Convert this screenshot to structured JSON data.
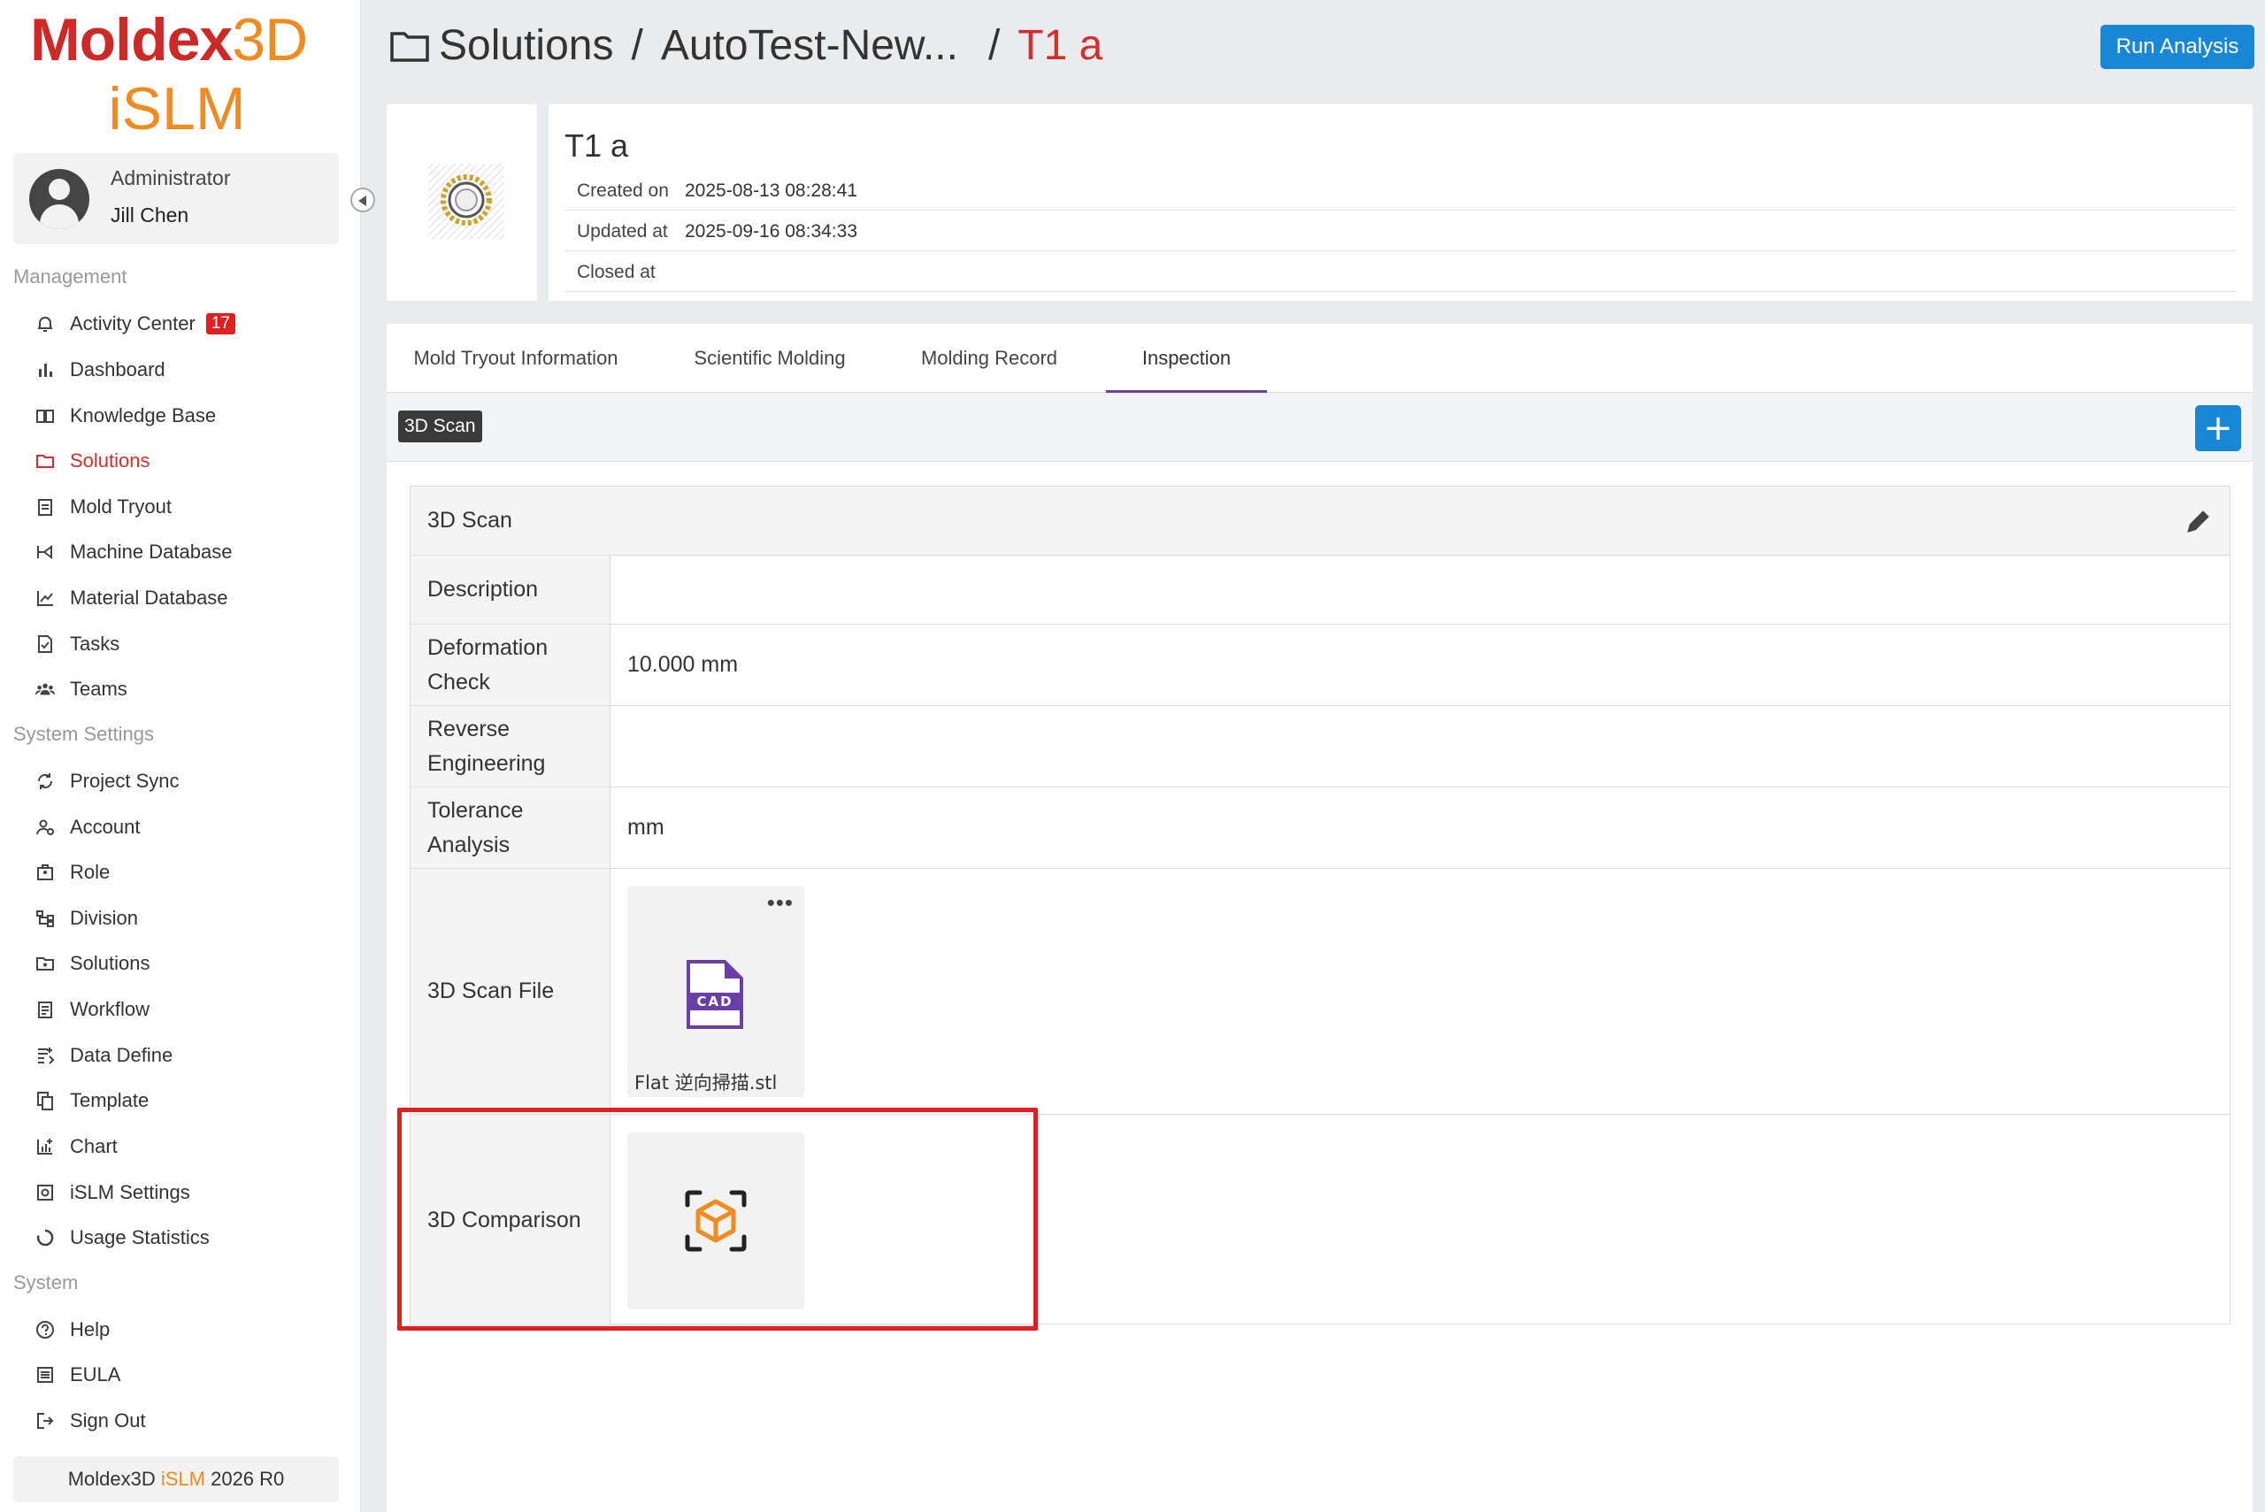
{
  "brand": {
    "line1a": "Moldex",
    "line1b": "3D",
    "line2": "iSLM"
  },
  "user": {
    "role": "Administrator",
    "name": "Jill Chen"
  },
  "sidebar": {
    "management_label": "Management",
    "management": [
      {
        "label": "Activity Center",
        "icon": "bell-icon",
        "badge": "17"
      },
      {
        "label": "Dashboard",
        "icon": "bar-chart-icon"
      },
      {
        "label": "Knowledge Base",
        "icon": "book-icon"
      },
      {
        "label": "Solutions",
        "icon": "folder-icon",
        "active": true
      },
      {
        "label": "Mold Tryout",
        "icon": "clipboard-icon"
      },
      {
        "label": "Machine Database",
        "icon": "machine-icon"
      },
      {
        "label": "Material Database",
        "icon": "material-chart-icon"
      },
      {
        "label": "Tasks",
        "icon": "task-icon"
      },
      {
        "label": "Teams",
        "icon": "team-icon"
      }
    ],
    "system_settings_label": "System Settings",
    "system_settings": [
      {
        "label": "Project Sync",
        "icon": "sync-icon"
      },
      {
        "label": "Account",
        "icon": "account-icon"
      },
      {
        "label": "Role",
        "icon": "role-icon"
      },
      {
        "label": "Division",
        "icon": "division-icon"
      },
      {
        "label": "Solutions",
        "icon": "solutions-settings-icon"
      },
      {
        "label": "Workflow",
        "icon": "workflow-icon"
      },
      {
        "label": "Data Define",
        "icon": "data-define-icon"
      },
      {
        "label": "Template",
        "icon": "template-icon"
      },
      {
        "label": "Chart",
        "icon": "chart-icon"
      },
      {
        "label": "iSLM Settings",
        "icon": "settings-icon"
      },
      {
        "label": "Usage Statistics",
        "icon": "usage-icon"
      }
    ],
    "system_label": "System",
    "system": [
      {
        "label": "Help",
        "icon": "help-icon"
      },
      {
        "label": "EULA",
        "icon": "eula-icon"
      },
      {
        "label": "Sign Out",
        "icon": "sign-out-icon"
      }
    ],
    "version": {
      "prefix": "Moldex3D ",
      "mid": "iSLM",
      "suffix": " 2026 R0"
    }
  },
  "header": {
    "crumb_root": "Solutions",
    "crumb_project": "AutoTest-New...",
    "separator": "/",
    "crumb_current": "T1 a",
    "run_label": "Run Analysis"
  },
  "info": {
    "title": "T1 a",
    "rows": [
      {
        "key": "Created on",
        "value": "2025-08-13 08:28:41"
      },
      {
        "key": "Updated at",
        "value": "2025-09-16 08:34:33"
      },
      {
        "key": "Closed at",
        "value": ""
      }
    ]
  },
  "tabs": [
    "Mold Tryout Information",
    "Scientific Molding",
    "Molding Record",
    "Inspection"
  ],
  "active_tab": "Inspection",
  "toolbar": {
    "chip": "3D Scan",
    "add_symbol": "+"
  },
  "panel": {
    "title": "3D Scan",
    "rows": {
      "description": {
        "label": "Description",
        "value": ""
      },
      "deformation": {
        "label": "Deformation Check",
        "value": "10.000 mm"
      },
      "reverse": {
        "label": "Reverse Engineering",
        "value": ""
      },
      "tolerance": {
        "label": "Tolerance Analysis",
        "value": "mm"
      },
      "scan_file": {
        "label": "3D Scan File",
        "file_name": "Flat 逆向掃描.stl",
        "file_badge": "CAD",
        "menu": "•••"
      },
      "comparison": {
        "label": "3D Comparison"
      }
    }
  },
  "colors": {
    "brand_red": "#cc2a27",
    "brand_orange": "#ef8b21",
    "primary_blue": "#1987d6",
    "highlight_red": "#e02020",
    "tab_accent": "#6b3fa0"
  }
}
